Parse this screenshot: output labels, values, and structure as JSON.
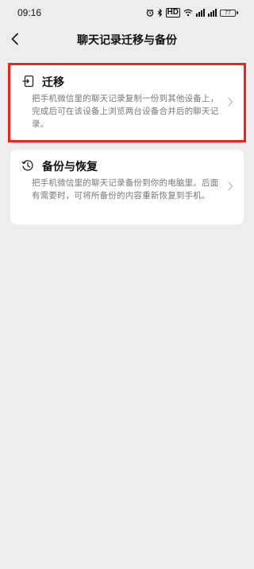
{
  "status_bar": {
    "time": "09:16",
    "hd_label": "HD",
    "battery_level": "77"
  },
  "header": {
    "title": "聊天记录迁移与备份"
  },
  "options": [
    {
      "title": "迁移",
      "description": "把手机微信里的聊天记录复制一份到其他设备上，完成后可在该设备上浏览两台设备合并后的聊天记录。",
      "icon": "migrate-icon",
      "highlighted": true
    },
    {
      "title": "备份与恢复",
      "description": "把手机微信里的聊天记录备份到你的电脑里。后面有需要时，可将所备份的内容重新恢复到手机。",
      "icon": "history-icon",
      "highlighted": false
    }
  ],
  "colors": {
    "background": "#ededed",
    "card": "#ffffff",
    "highlight": "#e5281e",
    "secondary_text": "#777777"
  }
}
